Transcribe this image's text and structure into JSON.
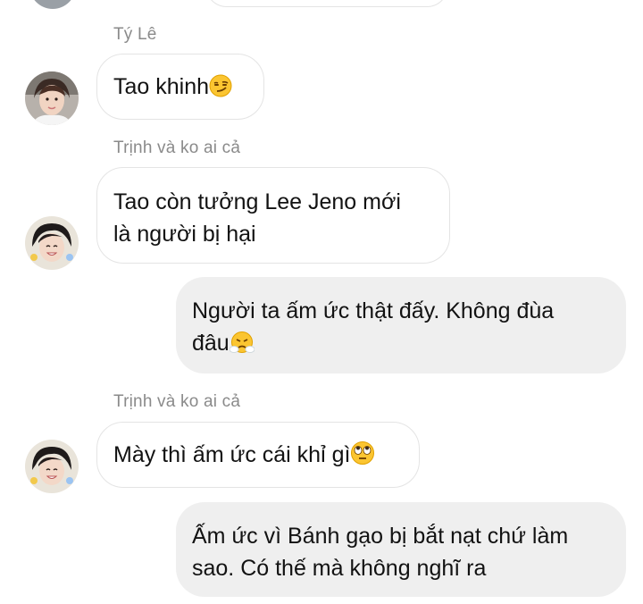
{
  "conversation": {
    "groups": [
      {
        "sender": "Tý Lê",
        "messages": [
          {
            "text": "Tao khinh",
            "emoji": "smirking-face"
          }
        ]
      },
      {
        "sender": "Trịnh và ko ai cả",
        "messages": [
          {
            "line1": "Tao còn tưởng Lee Jeno mới",
            "line2": "là người bị hại"
          }
        ]
      },
      {
        "sender": "",
        "outgoing": true,
        "messages": [
          {
            "line1": "Người ta ấm ức thật đấy. Không đùa",
            "line2": "đâu",
            "emoji": "face-with-steam-from-nose"
          }
        ]
      },
      {
        "sender": "Trịnh và ko ai cả",
        "messages": [
          {
            "text": "Mày thì ấm ức cái khỉ gì",
            "emoji": "face-with-rolling-eyes"
          }
        ]
      },
      {
        "sender": "",
        "outgoing": true,
        "messages": [
          {
            "line1": "Ấm ức vì Bánh gạo bị bắt nạt chứ làm",
            "line2": "sao. Có thế mà không nghĩ ra"
          }
        ]
      }
    ]
  },
  "colors": {
    "incoming_bubble_bg": "#ffffff",
    "incoming_bubble_border": "#e4e4e4",
    "outgoing_bubble_bg": "#efefef",
    "sender_name": "#8a8a8a",
    "message_text": "#121212"
  }
}
